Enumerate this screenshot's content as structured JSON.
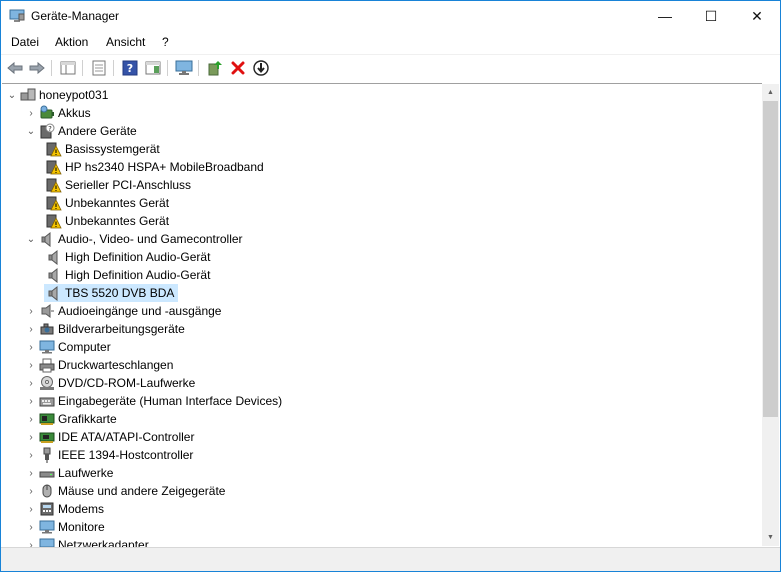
{
  "window": {
    "title": "Geräte-Manager",
    "minimize": "—",
    "maximize": "☐",
    "close": "✕"
  },
  "menu": [
    "Datei",
    "Aktion",
    "Ansicht",
    "?"
  ],
  "toolbar": {
    "icons": [
      "back-arrow-icon",
      "forward-arrow-icon",
      "show-hide-console-tree-icon",
      "properties-icon",
      "help-icon",
      "action-pane-icon",
      "computer-monitor-icon",
      "update-driver-icon",
      "uninstall-device-icon",
      "download-icon"
    ]
  },
  "tree": {
    "root": "honeypot031",
    "items": [
      {
        "label": "Akkus",
        "expander": "›",
        "icon": "battery-icon"
      },
      {
        "label": "Andere Geräte",
        "expander": "⌄",
        "icon": "unknown-device-icon"
      },
      {
        "label": "Basissystemgerät",
        "icon": "warning-device-icon",
        "child": true
      },
      {
        "label": "HP hs2340 HSPA+ MobileBroadband",
        "icon": "warning-device-icon",
        "child": true
      },
      {
        "label": "Serieller PCI-Anschluss",
        "icon": "warning-device-icon",
        "child": true
      },
      {
        "label": "Unbekanntes Gerät",
        "icon": "warning-device-icon",
        "child": true
      },
      {
        "label": "Unbekanntes Gerät",
        "icon": "warning-device-icon",
        "child": true
      },
      {
        "label": "Audio-, Video- und Gamecontroller",
        "expander": "⌄",
        "icon": "speaker-icon"
      },
      {
        "label": "High Definition Audio-Gerät",
        "icon": "speaker-icon",
        "child": true
      },
      {
        "label": "High Definition Audio-Gerät",
        "icon": "speaker-icon",
        "child": true
      },
      {
        "label": "TBS 5520 DVB BDA",
        "icon": "speaker-icon",
        "child": true,
        "selected": true
      },
      {
        "label": "Audioeingänge und -ausgänge",
        "expander": "›",
        "icon": "audio-io-icon"
      },
      {
        "label": "Bildverarbeitungsgeräte",
        "expander": "›",
        "icon": "camera-icon"
      },
      {
        "label": "Computer",
        "expander": "›",
        "icon": "computer-icon"
      },
      {
        "label": "Druckwarteschlangen",
        "expander": "›",
        "icon": "printer-icon"
      },
      {
        "label": "DVD/CD-ROM-Laufwerke",
        "expander": "›",
        "icon": "disc-drive-icon"
      },
      {
        "label": "Eingabegeräte (Human Interface Devices)",
        "expander": "›",
        "icon": "hid-icon"
      },
      {
        "label": "Grafikkarte",
        "expander": "›",
        "icon": "display-adapter-icon"
      },
      {
        "label": "IDE ATA/ATAPI-Controller",
        "expander": "›",
        "icon": "ide-controller-icon"
      },
      {
        "label": "IEEE 1394-Hostcontroller",
        "expander": "›",
        "icon": "firewire-icon"
      },
      {
        "label": "Laufwerke",
        "expander": "›",
        "icon": "disk-drive-icon"
      },
      {
        "label": "Mäuse und andere Zeigegeräte",
        "expander": "›",
        "icon": "mouse-icon"
      },
      {
        "label": "Modems",
        "expander": "›",
        "icon": "modem-icon"
      },
      {
        "label": "Monitore",
        "expander": "›",
        "icon": "monitor-icon"
      },
      {
        "label": "Netzwerkadapter",
        "expander": "›",
        "icon": "network-adapter-icon"
      }
    ]
  },
  "scrollbar": {
    "up": "▲",
    "down": "▼"
  },
  "colors": {
    "selection": "#cce8ff",
    "window_border": "#1883d7",
    "warning": "#f5c400",
    "uninstall_red": "#e01010"
  }
}
